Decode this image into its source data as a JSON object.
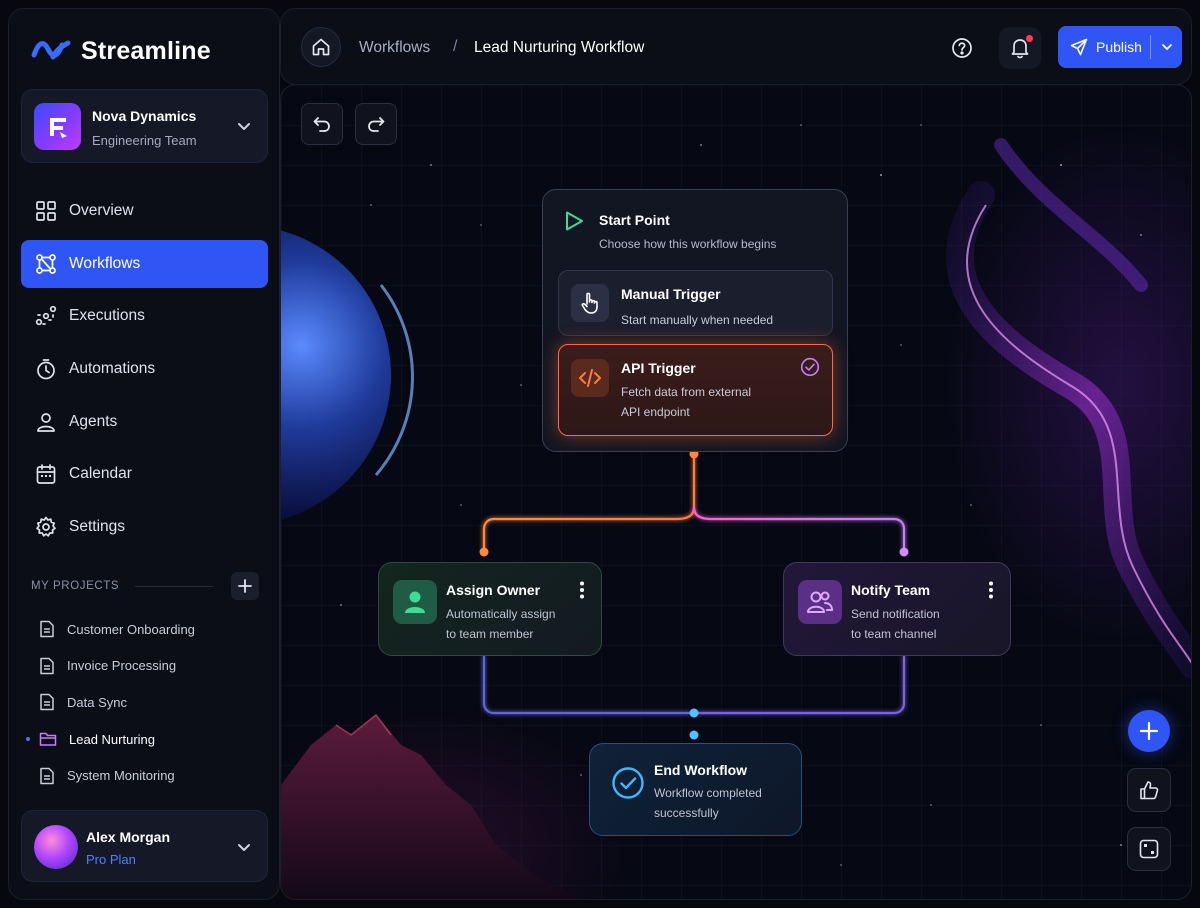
{
  "brand": {
    "name": "Streamline"
  },
  "org": {
    "name": "Nova Dynamics",
    "team": "Engineering Team"
  },
  "nav": [
    {
      "label": "Overview",
      "icon": "grid-icon",
      "active": false
    },
    {
      "label": "Workflows",
      "icon": "workflow-icon",
      "active": true
    },
    {
      "label": "Executions",
      "icon": "executions-icon",
      "active": false
    },
    {
      "label": "Automations",
      "icon": "timer-icon",
      "active": false
    },
    {
      "label": "Agents",
      "icon": "user-icon",
      "active": false
    },
    {
      "label": "Calendar",
      "icon": "calendar-icon",
      "active": false
    },
    {
      "label": "Settings",
      "icon": "gear-icon",
      "active": false
    }
  ],
  "projects": {
    "heading": "MY PROJECTS",
    "items": [
      {
        "label": "Customer Onboarding",
        "icon": "document-icon",
        "active": false
      },
      {
        "label": "Invoice Processing",
        "icon": "document-icon",
        "active": false
      },
      {
        "label": "Data Sync",
        "icon": "document-icon",
        "active": false
      },
      {
        "label": "Lead Nurturing",
        "icon": "folder-icon",
        "active": true
      },
      {
        "label": "System Monitoring",
        "icon": "document-icon",
        "active": false
      }
    ]
  },
  "user": {
    "name": "Alex Morgan",
    "plan": "Pro Plan"
  },
  "topbar": {
    "breadcrumb_parent": "Workflows",
    "breadcrumb_separator": "/",
    "breadcrumb_current": "Lead Nurturing Workflow",
    "publish_label": "Publish"
  },
  "workflow": {
    "start": {
      "title": "Start Point",
      "subtitle": "Choose how this workflow begins"
    },
    "manual_trigger": {
      "title": "Manual Trigger",
      "subtitle": "Start manually when needed"
    },
    "api_trigger": {
      "title": "API Trigger",
      "subtitle_line1": "Fetch data from external",
      "subtitle_line2": "API endpoint",
      "selected": true
    },
    "assign_owner": {
      "title": "Assign Owner",
      "subtitle_line1": "Automatically assign",
      "subtitle_line2": "to team member"
    },
    "notify_team": {
      "title": "Notify Team",
      "subtitle_line1": "Send notification",
      "subtitle_line2": "to team channel"
    },
    "end": {
      "title": "End Workflow",
      "subtitle_line1": "Workflow completed",
      "subtitle_line2": "successfully"
    }
  },
  "colors": {
    "accent": "#2f56f5",
    "api_trigger": "#ff6a3d",
    "assign": "#3ddc97",
    "notify": "#c77dff",
    "end": "#3fb6ff"
  }
}
